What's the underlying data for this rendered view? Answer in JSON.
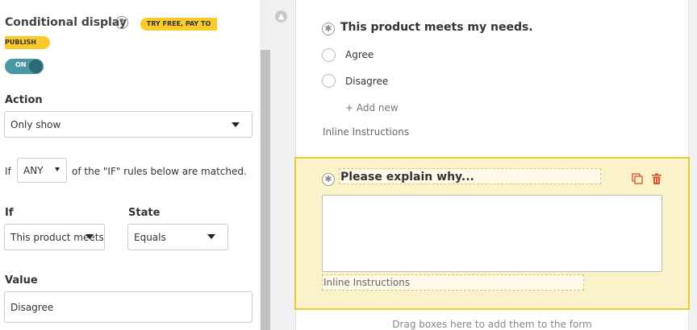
{
  "conditional": {
    "heading": "Conditional display",
    "help_glyph": "?",
    "badge_line1": "TRY FREE, PAY TO",
    "badge_line2": "PUBLISH",
    "toggle_label": "ON"
  },
  "action": {
    "label": "Action",
    "selected": "Only show"
  },
  "rule_match": {
    "prefix": "If",
    "selected": "ANY",
    "suffix": "of the \"IF\" rules below are matched."
  },
  "rule": {
    "if_label": "If",
    "if_selected": "This product meets",
    "state_label": "State",
    "state_selected": "Equals",
    "value_label": "Value",
    "value_text": "Disagree"
  },
  "form": {
    "question1": {
      "title": "This product meets my needs.",
      "options": [
        "Agree",
        "Disagree"
      ],
      "add_new": "+ Add new",
      "instructions": "Inline Instructions"
    },
    "question2": {
      "title": "Please explain why...",
      "instructions": "Inline Instructions"
    },
    "drop_hint": "Drag boxes here to add them to the form",
    "required_glyph": "✱"
  },
  "colors": {
    "badge": "#fbcb2c",
    "toggle": "#4a98a6",
    "selected_bg": "#faf2c8",
    "selected_border": "#e6cc2e",
    "action_icons": "#d9532c"
  }
}
